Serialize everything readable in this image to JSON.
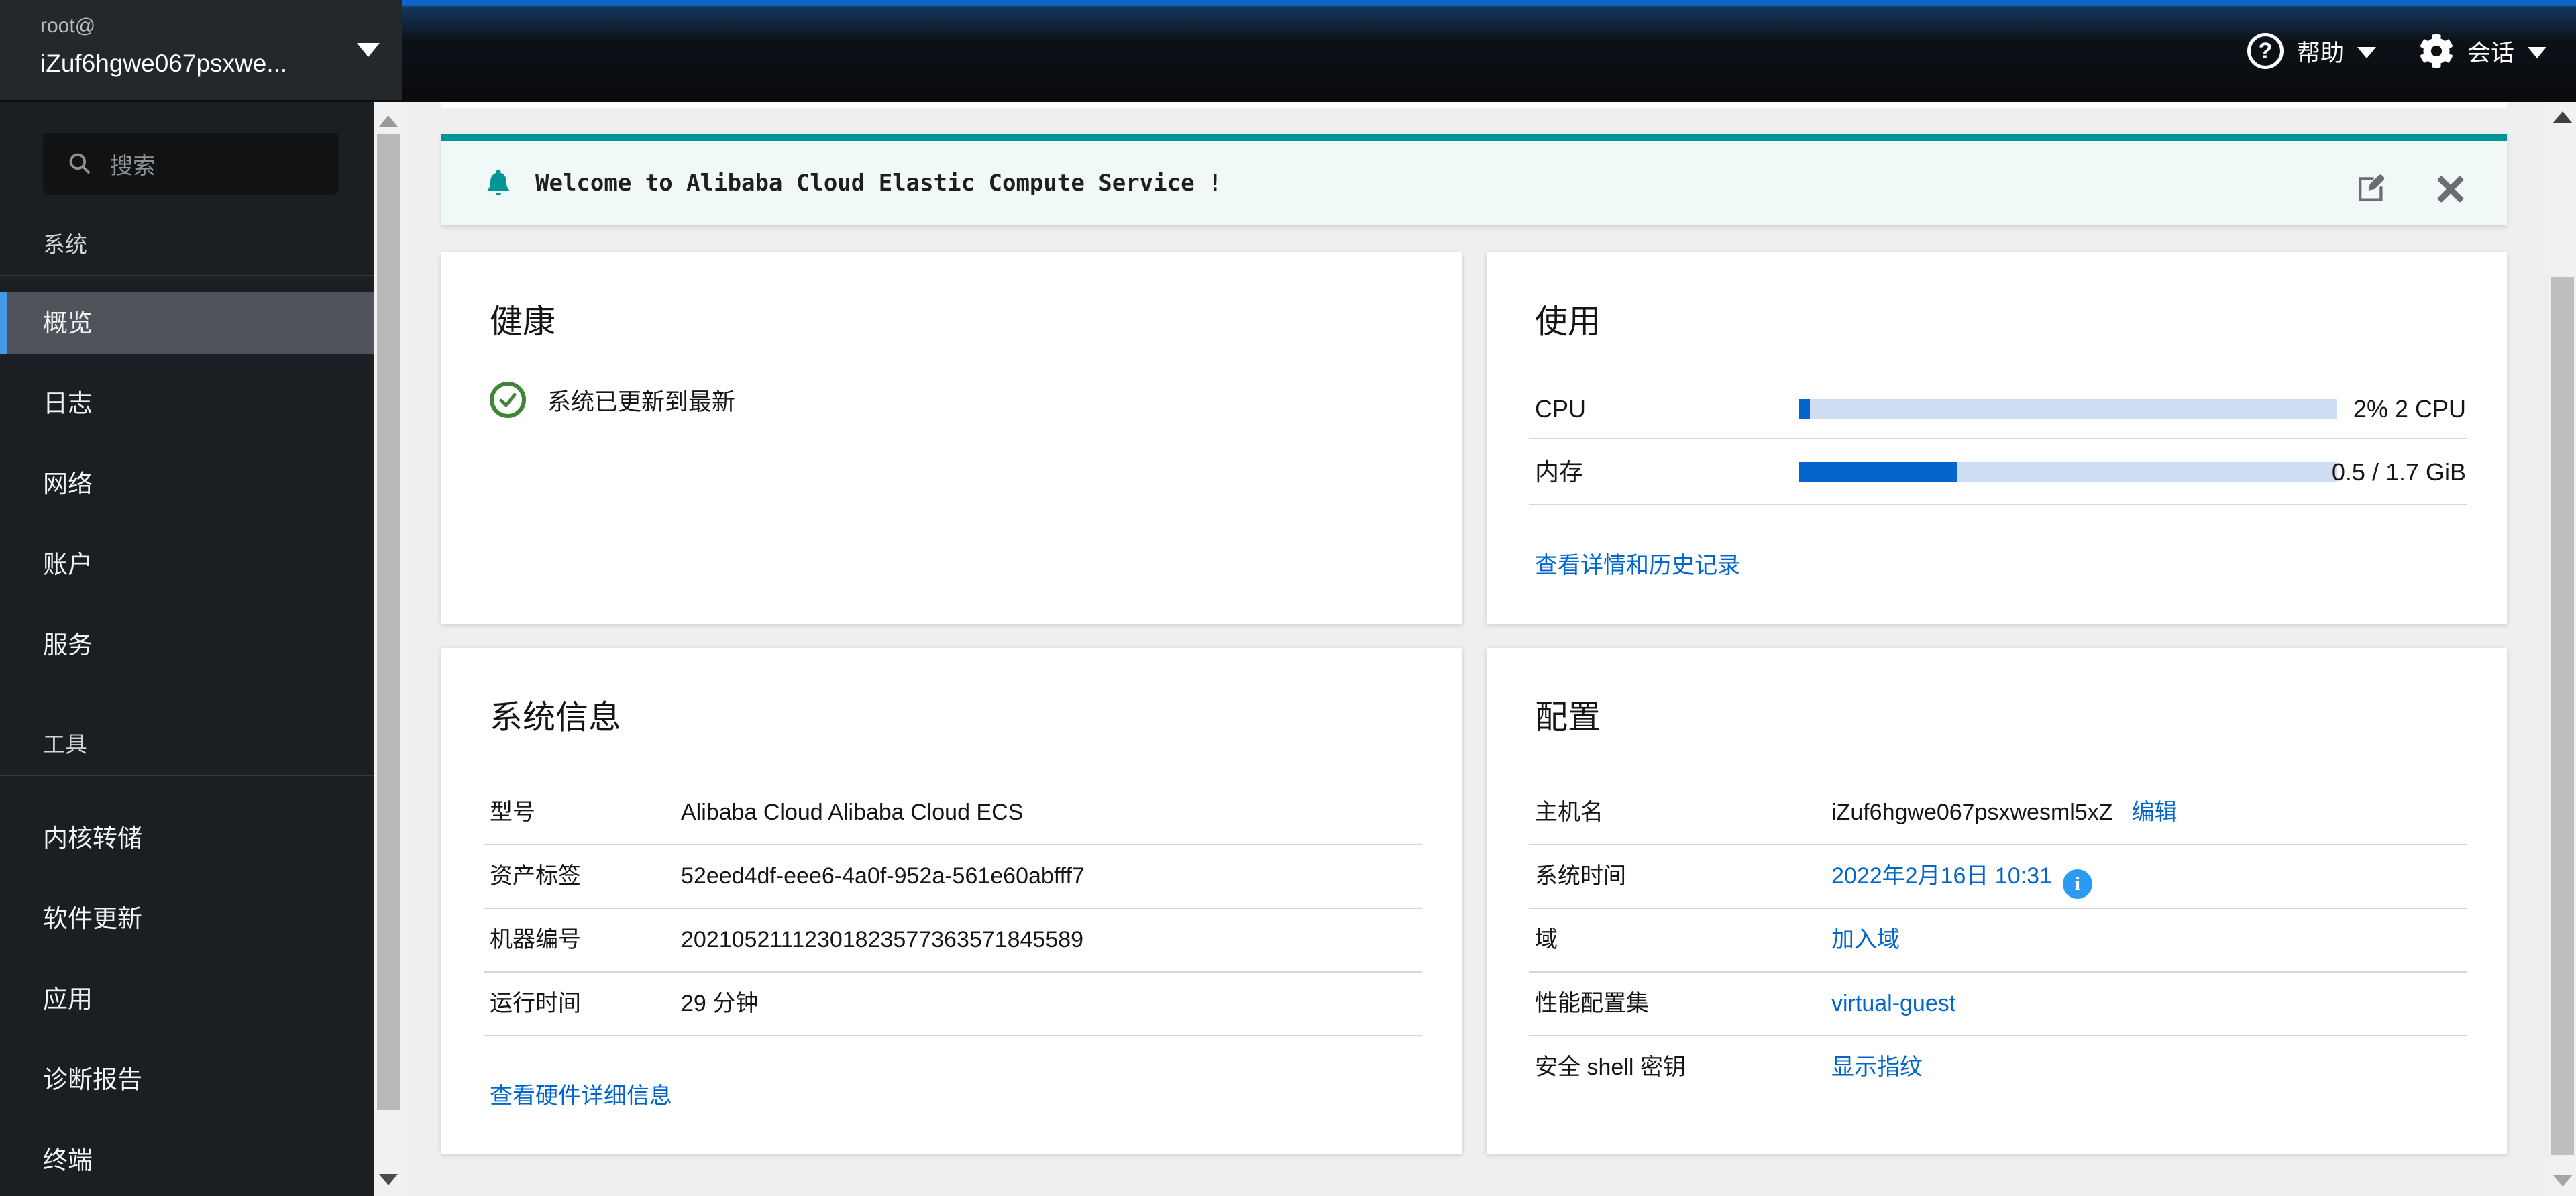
{
  "masthead": {
    "user": "root@",
    "host": "iZuf6hgwe067psxwe...",
    "help_label": "帮助",
    "help_icon_glyph": "?",
    "session_label": "会话",
    "info_icon_glyph": "i"
  },
  "sidebar": {
    "search_placeholder": "搜索",
    "sections": [
      {
        "label": "系统",
        "items": [
          {
            "label": "概览",
            "active": true
          },
          {
            "label": "日志",
            "active": false
          },
          {
            "label": "网络",
            "active": false
          },
          {
            "label": "账户",
            "active": false
          },
          {
            "label": "服务",
            "active": false
          }
        ]
      },
      {
        "label": "工具",
        "items": [
          {
            "label": "内核转储",
            "active": false
          },
          {
            "label": "软件更新",
            "active": false
          },
          {
            "label": "应用",
            "active": false
          },
          {
            "label": "诊断报告",
            "active": false
          },
          {
            "label": "终端",
            "active": false
          }
        ]
      }
    ]
  },
  "banner": {
    "text": "Welcome to Alibaba Cloud Elastic Compute Service !"
  },
  "cards": {
    "health": {
      "title": "健康",
      "status": "系统已更新到最新"
    },
    "usage": {
      "title": "使用",
      "rows": [
        {
          "label": "CPU",
          "percent": 2,
          "value": "2% 2 CPU"
        },
        {
          "label": "内存",
          "percent": 29.4,
          "value": "0.5 / 1.7 GiB"
        }
      ],
      "link": "查看详情和历史记录"
    },
    "system_info": {
      "title": "系统信息",
      "rows": [
        {
          "label": "型号",
          "value": "Alibaba Cloud Alibaba Cloud ECS"
        },
        {
          "label": "资产标签",
          "value": "52eed4df-eee6-4a0f-952a-561e60abfff7"
        },
        {
          "label": "机器编号",
          "value": "20210521112301823577363571845589"
        },
        {
          "label": "运行时间",
          "value": "29 分钟"
        }
      ],
      "link": "查看硬件详细信息"
    },
    "config": {
      "title": "配置",
      "rows": [
        {
          "label": "主机名",
          "value": "iZuf6hgwe067psxwesml5xZ",
          "link": false,
          "extra": "编辑",
          "info": false
        },
        {
          "label": "系统时间",
          "value": "2022年2月16日 10:31",
          "link": true,
          "extra": "",
          "info": true
        },
        {
          "label": "域",
          "value": "加入域",
          "link": true,
          "extra": "",
          "info": false
        },
        {
          "label": "性能配置集",
          "value": "virtual-guest",
          "link": true,
          "extra": "",
          "info": false
        },
        {
          "label": "安全 shell 密钥",
          "value": "显示指纹",
          "link": true,
          "extra": "",
          "info": false
        }
      ]
    }
  },
  "colors": {
    "accent_blue": "#0066cc",
    "masthead_topbar": "#0f65c8",
    "nav_active_indicator": "#459ae8",
    "banner_teal": "#009596",
    "success_green": "#3e8635",
    "info_blue": "#2b9af3",
    "progress_track": "#cfdef2",
    "progress_fill": "#0465cc"
  }
}
